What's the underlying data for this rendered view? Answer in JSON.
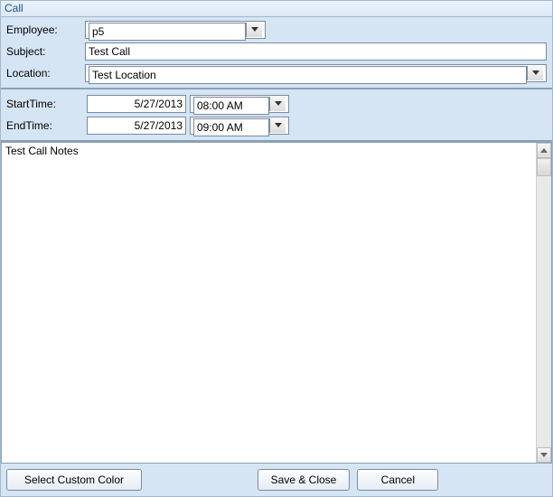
{
  "title": "Call",
  "labels": {
    "employee": "Employee:",
    "subject": "Subject:",
    "location": "Location:",
    "startTime": "StartTime:",
    "endTime": "EndTime:"
  },
  "fields": {
    "employee": "p5",
    "subject": "Test Call",
    "location": "Test Location",
    "startDate": "5/27/2013",
    "startTime": "08:00 AM",
    "endDate": "5/27/2013",
    "endTime": "09:00 AM",
    "notes": "Test Call Notes"
  },
  "buttons": {
    "selectColor": "Select Custom Color",
    "saveClose": "Save & Close",
    "cancel": "Cancel"
  }
}
